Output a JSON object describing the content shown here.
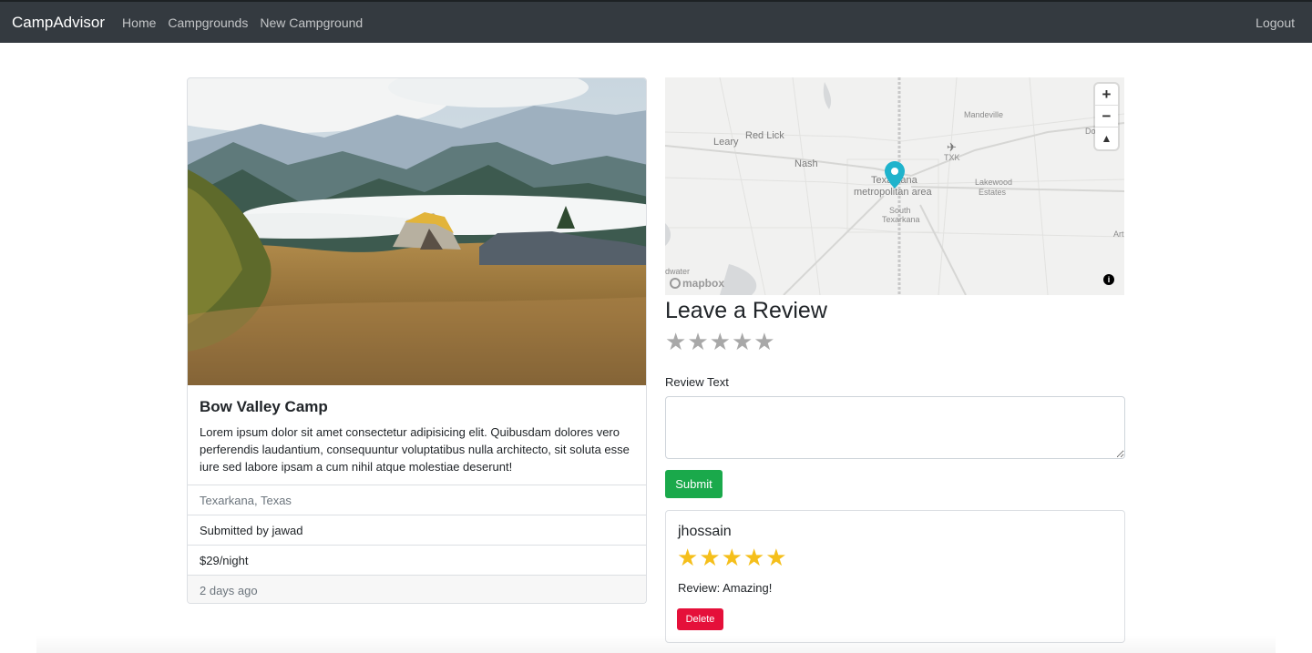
{
  "navbar": {
    "brand": "CampAdvisor",
    "links": [
      "Home",
      "Campgrounds",
      "New Campground"
    ],
    "logout": "Logout"
  },
  "campground": {
    "title": "Bow Valley Camp",
    "description": "Lorem ipsum dolor sit amet consectetur adipisicing elit. Quibusdam dolores vero perferendis laudantium, consequuntur voluptatibus nulla architecto, sit soluta esse iure sed labore ipsam a cum nihil atque molestiae deserunt!",
    "location": "Texarkana, Texas",
    "submitted_by": "Submitted by jawad",
    "price": "$29/night",
    "age": "2 days ago"
  },
  "map": {
    "labels": {
      "red_lick": "Red Lick",
      "leary": "Leary",
      "nash": "Nash",
      "mandeville": "Mandeville",
      "txk": "TXK",
      "texarkana": "Texarkana",
      "metro": "metropolitan area",
      "lakewood": "Lakewood",
      "estates": "Estates",
      "south": "South",
      "texarkana_south": "Texarkana",
      "dc": "Do",
      "art": "Art",
      "edgewater": "dwater"
    },
    "zoom_in": "+",
    "zoom_out": "−",
    "compass": "▲",
    "logo": "mapbox",
    "info": "i",
    "pin_color": "#1fb3cc"
  },
  "review_form": {
    "heading": "Leave a Review",
    "rating_stars": 5,
    "label": "Review Text",
    "textarea_value": "",
    "submit_label": "Submit"
  },
  "reviews": [
    {
      "user": "jhossain",
      "rating": 5,
      "body": "Review: Amazing!",
      "delete_label": "Delete"
    }
  ],
  "colors": {
    "navbar": "#343a40",
    "submit": "#1aa94b",
    "delete": "#e5103a",
    "star_filled": "#f5bf1b",
    "star_empty": "#a8a8a8"
  }
}
